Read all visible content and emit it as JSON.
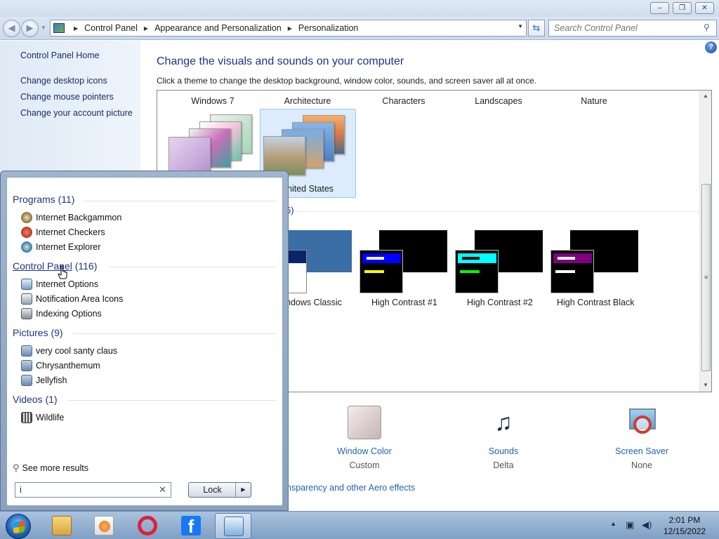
{
  "window": {
    "minimize": "–",
    "restore": "❐",
    "close": "✕"
  },
  "address": {
    "crumbs": [
      "Control Panel",
      "Appearance and Personalization",
      "Personalization"
    ],
    "search_placeholder": "Search Control Panel"
  },
  "sidebar": {
    "home": "Control Panel Home",
    "links": [
      "Change desktop icons",
      "Change mouse pointers",
      "Change your account picture"
    ]
  },
  "main": {
    "title": "Change the visuals and sounds on your computer",
    "subtitle": "Click a theme to change the desktop background, window color, sounds, and screen saver all at once.",
    "theme_names_top": [
      "Windows 7",
      "Architecture",
      "Characters",
      "Landscapes",
      "Nature"
    ],
    "selected_theme_caption": "nited States",
    "basic_group_count": "6)",
    "basic_themes": [
      "ndows Classic",
      "High Contrast #1",
      "High Contrast #2",
      "High Contrast Black"
    ],
    "aero_link": "nsparency and other Aero effects"
  },
  "settings": [
    {
      "label": "Window Color",
      "value": "Custom"
    },
    {
      "label": "Sounds",
      "value": "Delta"
    },
    {
      "label": "Screen Saver",
      "value": "None"
    }
  ],
  "startmenu": {
    "groups": [
      {
        "title": "Programs",
        "count": "(11)",
        "items": [
          "Internet Backgammon",
          "Internet Checkers",
          "Internet Explorer"
        ]
      },
      {
        "title": "Control Panel",
        "count": "(116)",
        "items": [
          "Internet Options",
          "Notification Area Icons",
          "Indexing Options"
        ]
      },
      {
        "title": "Pictures",
        "count": "(9)",
        "items": [
          "very cool santy claus",
          "Chrysanthemum",
          "Jellyfish"
        ]
      },
      {
        "title": "Videos",
        "count": "(1)",
        "items": [
          "Wildlife"
        ]
      }
    ],
    "see_more": "See more results",
    "search_value": "i",
    "lock_label": "Lock"
  },
  "taskbar": {
    "time": "2:01 PM",
    "date": "12/15/2022"
  },
  "colors": {
    "link_blue": "#1e63b5",
    "heading_blue": "#1e3287",
    "hc1_bar": "#0000ff",
    "hc2_bar": "#00ffff",
    "hcblack_bar": "#800080"
  }
}
